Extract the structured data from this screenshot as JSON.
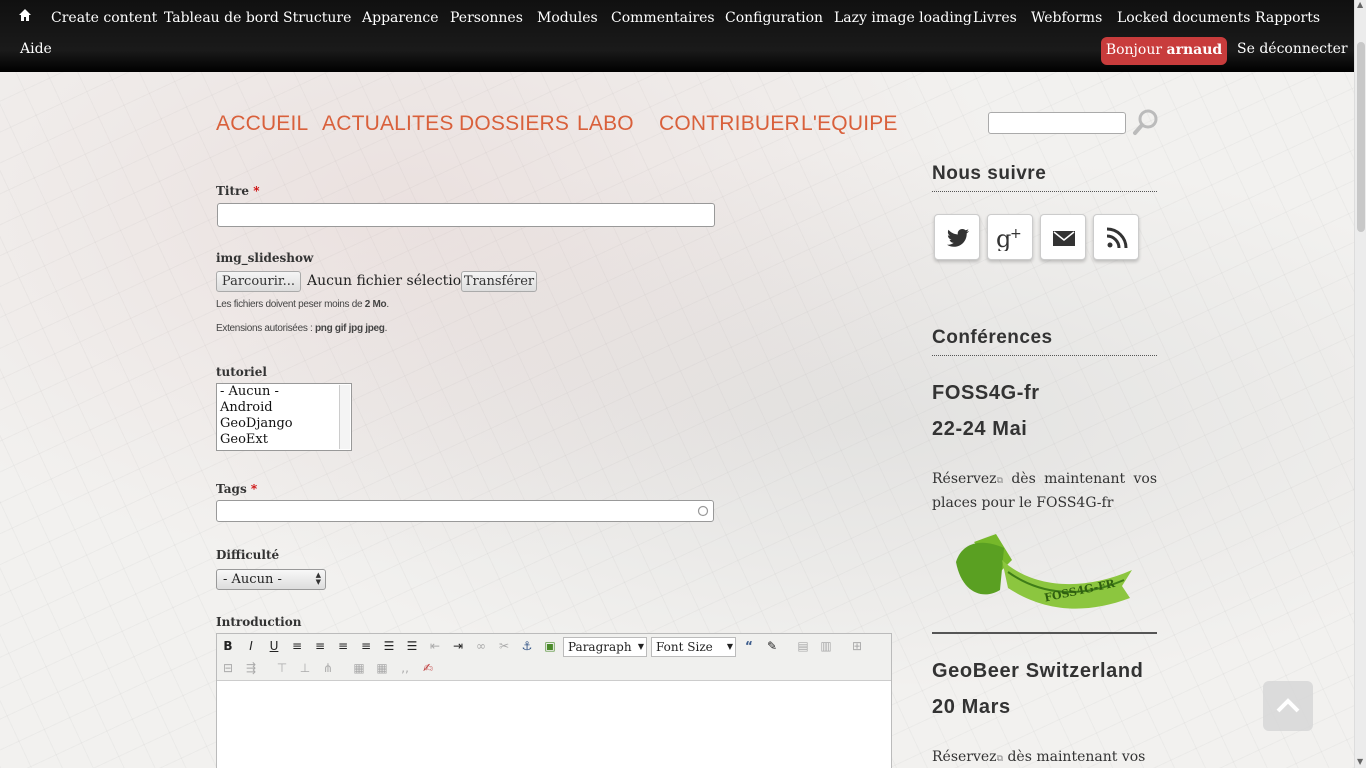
{
  "toolbar": {
    "home_icon": "home-icon",
    "items": [
      "Create content",
      "Tableau de bord",
      "Structure",
      "Apparence",
      "Personnes",
      "Modules",
      "Commentaires",
      "Configuration",
      "Lazy image loading",
      "Livres",
      "Webforms",
      "Locked documents",
      "Rapports"
    ],
    "help": "Aide",
    "greeting": "Bonjour",
    "username": "arnaud",
    "logout": "Se déconnecter",
    "accent": "#c83c3c"
  },
  "nav": {
    "items": [
      "ACCUEIL",
      "ACTUALITES",
      "DOSSIERS",
      "LABO",
      "CONTRIBUER",
      "L'EQUIPE"
    ],
    "color": "#d9603b",
    "search_value": "",
    "search_icon": "search-icon"
  },
  "form": {
    "title_label": "Titre",
    "required_mark": "*",
    "title_value": "",
    "slideshow_label": "img_slideshow",
    "browse_button": "Parcourir...",
    "no_file": "Aucun fichier sélectionné.",
    "upload_button": "Transférer",
    "size_desc": "Les fichiers doivent peser moins de",
    "size_value": "2 Mo",
    "ext_desc": "Extensions autorisées :",
    "ext_value": "png gif jpg jpeg",
    "tutorial_label": "tutoriel",
    "tutorial_options": [
      "- Aucun -",
      "Android",
      "GeoDjango",
      "GeoExt"
    ],
    "tags_label": "Tags",
    "tags_value": "",
    "difficulty_label": "Difficulté",
    "difficulty_value": "- Aucun -",
    "intro_label": "Introduction",
    "editor_format": "Paragraph",
    "editor_size": "Font Size"
  },
  "sidebar": {
    "follow_title": "Nous suivre",
    "social": [
      "twitter-icon",
      "google-plus-icon",
      "email-icon",
      "rss-icon"
    ],
    "conferences_title": "Conférences",
    "conf1_name": "FOSS4G-fr",
    "conf1_date": "22-24 Mai",
    "conf1_link": "Réservez",
    "conf1_text": "dès maintenant vos places pour le FOSS4G-fr",
    "conf1_logo_text": "FOSS4G-FR",
    "conf2_name": "GeoBeer Switzerland",
    "conf2_date": "20 Mars",
    "conf2_link": "Réservez",
    "conf2_text": "dès maintenant vos"
  }
}
